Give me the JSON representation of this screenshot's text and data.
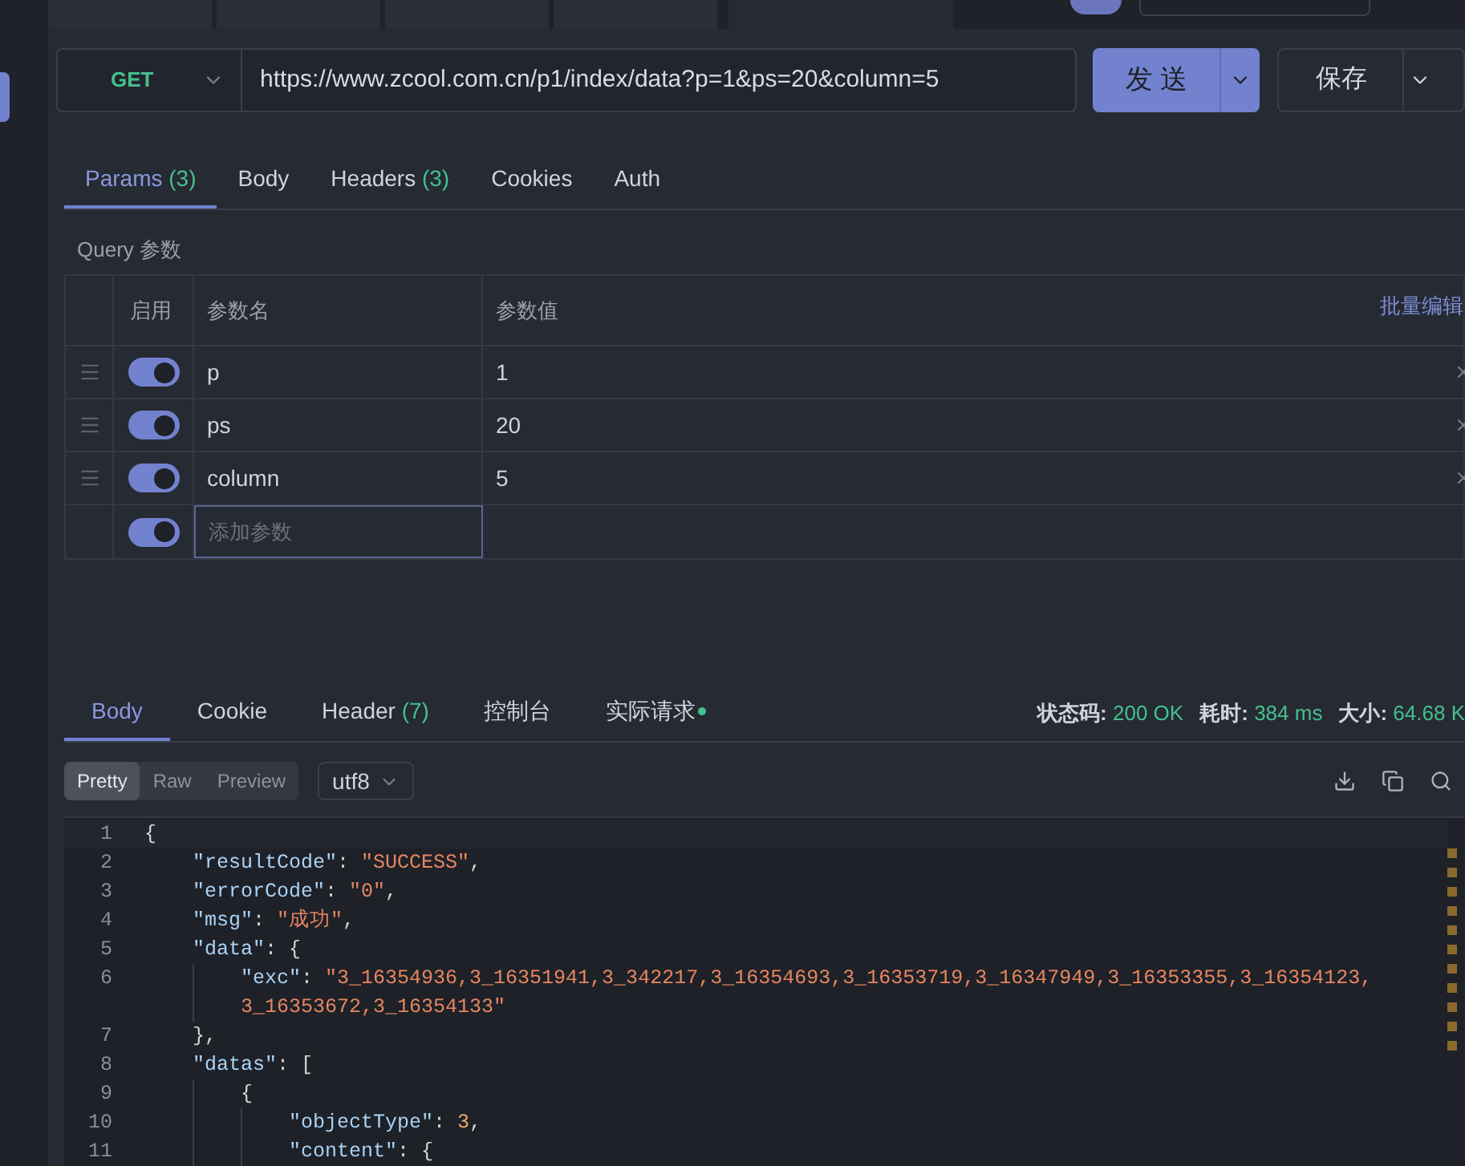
{
  "top_tabs": [
    {
      "selected": false
    },
    {
      "selected": false
    },
    {
      "selected": false
    },
    {
      "selected": false
    },
    {
      "selected": true
    }
  ],
  "request": {
    "method": "GET",
    "url": "https://www.zcool.com.cn/p1/index/data?p=1&ps=20&column=5",
    "send": "发 送",
    "save": "保存"
  },
  "request_tabs": [
    {
      "label": "Params",
      "count": "(3)",
      "selected": true
    },
    {
      "label": "Body",
      "selected": false
    },
    {
      "label": "Headers",
      "count": "(3)",
      "selected": false
    },
    {
      "label": "Cookies",
      "selected": false
    },
    {
      "label": "Auth",
      "selected": false
    }
  ],
  "query_title": "Query 参数",
  "params_table": {
    "columns": [
      "启用",
      "参数名",
      "参数值"
    ],
    "bulk_edit": "批量编辑",
    "rows": [
      {
        "on": true,
        "name": "p",
        "value": "1"
      },
      {
        "on": true,
        "name": "ps",
        "value": "20"
      },
      {
        "on": true,
        "name": "column",
        "value": "5"
      }
    ],
    "new_row": {
      "on": true,
      "placeholder": "添加参数"
    }
  },
  "response_tabs": [
    {
      "label": "Body",
      "selected": true
    },
    {
      "label": "Cookie",
      "selected": false
    },
    {
      "label": "Header",
      "count": "(7)",
      "selected": false
    },
    {
      "label": "控制台",
      "selected": false
    },
    {
      "label": "实际请求",
      "dot": true,
      "selected": false
    }
  ],
  "response_status": [
    {
      "label": "状态码:",
      "value": "200 OK"
    },
    {
      "label": "耗时:",
      "value": "384 ms"
    },
    {
      "label": "大小:",
      "value": "64.68 K"
    }
  ],
  "view_modes": [
    {
      "label": "Pretty",
      "selected": true
    },
    {
      "label": "Raw",
      "selected": false
    },
    {
      "label": "Preview",
      "selected": false
    }
  ],
  "encoding": "utf8",
  "code_lines": [
    {
      "number": "1",
      "tokens": [
        {
          "kind": "punct",
          "text": "{"
        }
      ],
      "children": [
        {
          "number": "2",
          "tokens": [
            {
              "kind": "key",
              "text": "\"resultCode\""
            },
            {
              "kind": "punct",
              "text": ": "
            },
            {
              "kind": "str",
              "text": "\"SUCCESS\""
            },
            {
              "kind": "punct",
              "text": ","
            }
          ]
        },
        {
          "number": "3",
          "tokens": [
            {
              "kind": "key",
              "text": "\"errorCode\""
            },
            {
              "kind": "punct",
              "text": ": "
            },
            {
              "kind": "str",
              "text": "\"0\""
            },
            {
              "kind": "punct",
              "text": ","
            }
          ]
        },
        {
          "number": "4",
          "tokens": [
            {
              "kind": "key",
              "text": "\"msg\""
            },
            {
              "kind": "punct",
              "text": ": "
            },
            {
              "kind": "str",
              "text": "\"成功\""
            },
            {
              "kind": "punct",
              "text": ","
            }
          ]
        },
        {
          "number": "5",
          "tokens": [
            {
              "kind": "key",
              "text": "\"data\""
            },
            {
              "kind": "punct",
              "text": ": {"
            }
          ],
          "children": [
            {
              "number": "6",
              "tokens": [
                {
                  "kind": "key",
                  "text": "\"exc\""
                },
                {
                  "kind": "punct",
                  "text": ": "
                },
                {
                  "kind": "str",
                  "text": "\"3_16354936,3_16351941,3_342217,3_16354693,3_16353719,3_16347949,3_16353355,3_16354123,"
                }
              ]
            },
            {
              "tokens": [
                {
                  "kind": "str",
                  "text": "3_16353672,3_16354133\""
                }
              ]
            }
          ]
        },
        {
          "number": "7",
          "tokens": [
            {
              "kind": "punct",
              "text": "},"
            }
          ]
        },
        {
          "number": "8",
          "tokens": [
            {
              "kind": "key",
              "text": "\"datas\""
            },
            {
              "kind": "punct",
              "text": ": ["
            }
          ],
          "children": [
            {
              "number": "9",
              "tokens": [
                {
                  "kind": "punct",
                  "text": "{"
                }
              ],
              "children": [
                {
                  "number": "10",
                  "tokens": [
                    {
                      "kind": "key",
                      "text": "\"objectType\""
                    },
                    {
                      "kind": "punct",
                      "text": ": "
                    },
                    {
                      "kind": "num",
                      "text": "3"
                    },
                    {
                      "kind": "punct",
                      "text": ","
                    }
                  ]
                },
                {
                  "number": "11",
                  "tokens": [
                    {
                      "kind": "key",
                      "text": "\"content\""
                    },
                    {
                      "kind": "punct",
                      "text": ": {"
                    }
                  ]
                }
              ]
            }
          ]
        }
      ]
    }
  ]
}
